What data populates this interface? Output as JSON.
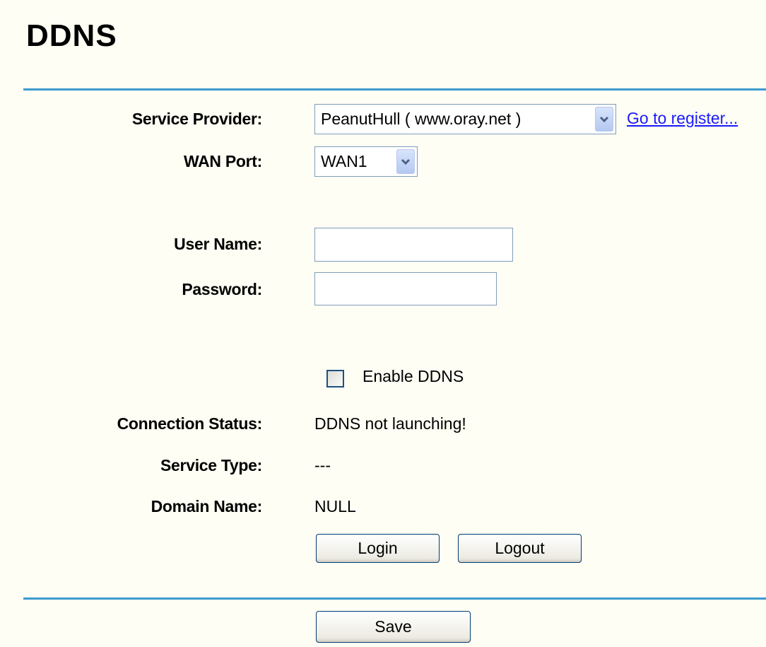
{
  "page": {
    "title": "DDNS"
  },
  "form": {
    "service_provider": {
      "label": "Service Provider:",
      "selected": "PeanutHull ( www.oray.net )",
      "register_link": "Go to register..."
    },
    "wan_port": {
      "label": "WAN Port:",
      "selected": "WAN1"
    },
    "user_name": {
      "label": "User Name:",
      "value": ""
    },
    "password": {
      "label": "Password:",
      "value": ""
    },
    "enable_ddns": {
      "label": "Enable DDNS",
      "checked": false
    }
  },
  "status": {
    "connection_status": {
      "label": "Connection Status:",
      "value": "DDNS not launching!"
    },
    "service_type": {
      "label": "Service Type:",
      "value": "---"
    },
    "domain_name": {
      "label": "Domain Name:",
      "value": "NULL"
    }
  },
  "buttons": {
    "login": "Login",
    "logout": "Logout",
    "save": "Save"
  },
  "colors": {
    "background": "#fefef4",
    "divider": "#3c9ad0",
    "link": "#1a1aff",
    "input_border": "#7f9db9"
  },
  "icons": {
    "dropdown": "chevron-down-icon"
  }
}
